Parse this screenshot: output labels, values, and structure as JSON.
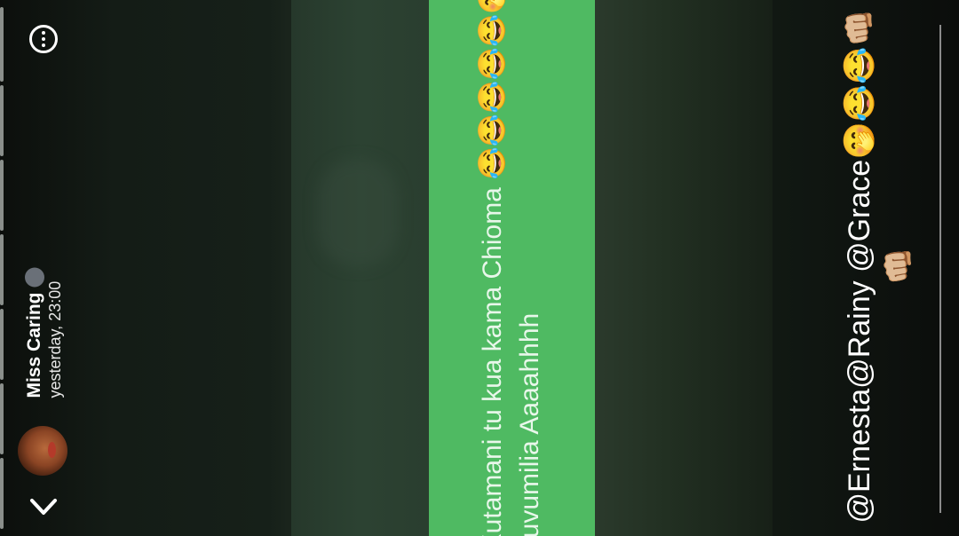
{
  "status": {
    "user_name": "Miss Caring",
    "timestamp": "yesterday, 23:00",
    "avatar_icon": "profile-photo",
    "badge_icon": "mini-avatar-icon"
  },
  "controls": {
    "more_icon": "more-options-icon",
    "back_icon": "chevron-down-icon"
  },
  "content": {
    "message_line1": "Kutamani tu kua kama Chioma 😂😂😂😂😂🤭",
    "message_line2": "kuvumilia Aaaahhhh",
    "caption_line1": "@Ernesta@Rainy @Grace🤭😂😂👊🏼",
    "caption_line2": "👊🏼"
  },
  "colors": {
    "green_band": "#4fba62",
    "dark_panel": "#2c4232",
    "background": "#141a15"
  }
}
